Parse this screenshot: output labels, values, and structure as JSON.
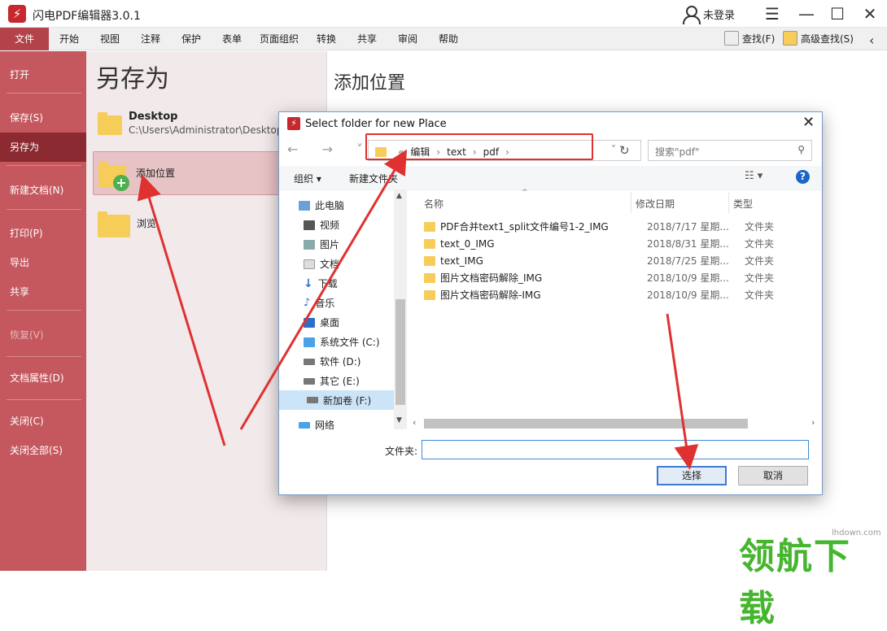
{
  "app": {
    "title": "闪电PDF编辑器3.0.1",
    "login": "未登录",
    "logo": "⚡"
  },
  "menu": [
    "文件",
    "开始",
    "视图",
    "注释",
    "保护",
    "表单",
    "页面组织",
    "转换",
    "共享",
    "审阅",
    "帮助"
  ],
  "toolbar": {
    "search": "查找(F)",
    "advanced_search": "高级查找(S)"
  },
  "sidebar": [
    "打开",
    "保存(S)",
    "另存为",
    "新建文档(N)",
    "打印(P)",
    "导出",
    "共享",
    "恢复(V)",
    "文档属性(D)",
    "关闭(C)",
    "关闭全部(S)"
  ],
  "saveas": {
    "title": "另存为",
    "locations": [
      {
        "name": "Desktop",
        "path": "C:\\Users\\Administrator\\Desktop"
      },
      {
        "name": "添加位置"
      },
      {
        "name": "浏览"
      }
    ]
  },
  "right": {
    "title": "添加位置"
  },
  "dialog": {
    "title": "Select folder for new Place",
    "breadcrumb": [
      "«",
      "编辑",
      "›",
      "text",
      "›",
      "pdf",
      "›"
    ],
    "search_placeholder": "搜索\"pdf\"",
    "organize": "组织 ▾",
    "new_folder": "新建文件夹",
    "tree": [
      "此电脑",
      "视频",
      "图片",
      "文档",
      "下载",
      "音乐",
      "桌面",
      "系统文件 (C:)",
      "软件 (D:)",
      "其它 (E:)",
      "新加卷 (F:)",
      "网络"
    ],
    "columns": [
      "名称",
      "修改日期",
      "类型"
    ],
    "files": [
      {
        "name": "PDF合并text1_split文件编号1-2_IMG",
        "date": "2018/7/17 星期...",
        "type": "文件夹"
      },
      {
        "name": "text_0_IMG",
        "date": "2018/8/31 星期...",
        "type": "文件夹"
      },
      {
        "name": "text_IMG",
        "date": "2018/7/25 星期...",
        "type": "文件夹"
      },
      {
        "name": "图片文档密码解除_IMG",
        "date": "2018/10/9 星期...",
        "type": "文件夹"
      },
      {
        "name": "图片文档密码解除-IMG",
        "date": "2018/10/9 星期...",
        "type": "文件夹"
      }
    ],
    "folder_label": "文件夹:",
    "folder_value": "",
    "select": "选择",
    "cancel": "取消"
  },
  "watermark": {
    "text": "领航下载",
    "url": "lhdown.com"
  }
}
